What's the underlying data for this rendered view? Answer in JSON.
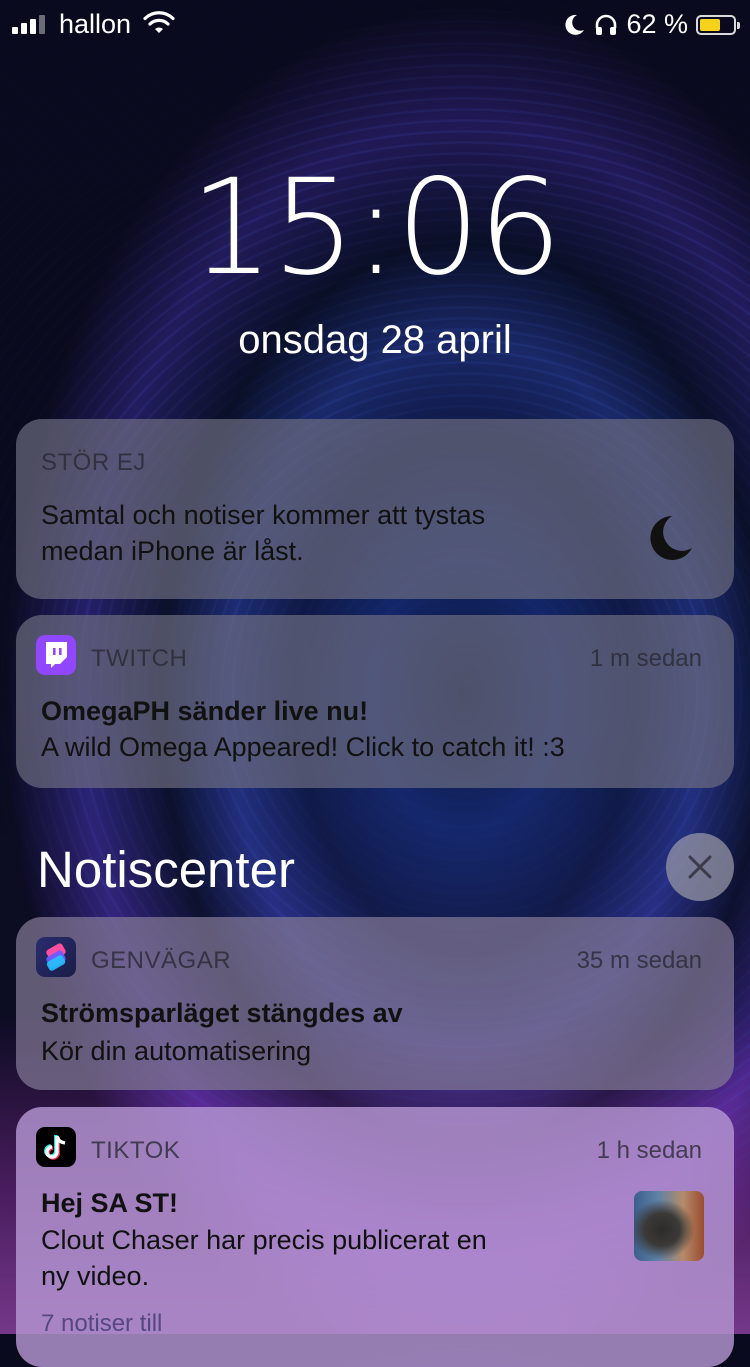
{
  "status_bar": {
    "carrier": "hallon",
    "battery_percent": "62 %",
    "battery_level": 0.62,
    "battery_color": "#f7d21b",
    "icons": [
      "signal-icon",
      "wifi-icon",
      "moon-icon",
      "headphones-icon",
      "battery-icon"
    ]
  },
  "lock_screen": {
    "time": "15:06",
    "date": "onsdag 28 april"
  },
  "dnd": {
    "label": "STÖR EJ",
    "body_line1": "Samtal och notiser kommer att tystas",
    "body_line2": "medan iPhone är låst.",
    "icon": "moon-icon"
  },
  "notifications_top": [
    {
      "app": "TWITCH",
      "time": "1 m sedan",
      "title": "OmegaPH sänder live nu!",
      "body": "A wild Omega Appeared! Click to catch it! :3",
      "icon": "twitch-icon",
      "icon_color": "#9146ff"
    }
  ],
  "notification_center": {
    "title": "Notiscenter",
    "clear_icon": "close-icon",
    "items": [
      {
        "app": "GENVÄGAR",
        "time": "35 m sedan",
        "title": "Strömsparläget stängdes av",
        "body": "Kör din automatisering",
        "icon": "shortcuts-icon"
      },
      {
        "app": "TIKTOK",
        "time": "1 h sedan",
        "title": "Hej SA ST!",
        "body_line1": "Clout Chaser har precis publicerat en",
        "body_line2": "ny video.",
        "more": "7 notiser till",
        "icon": "tiktok-icon"
      }
    ]
  }
}
